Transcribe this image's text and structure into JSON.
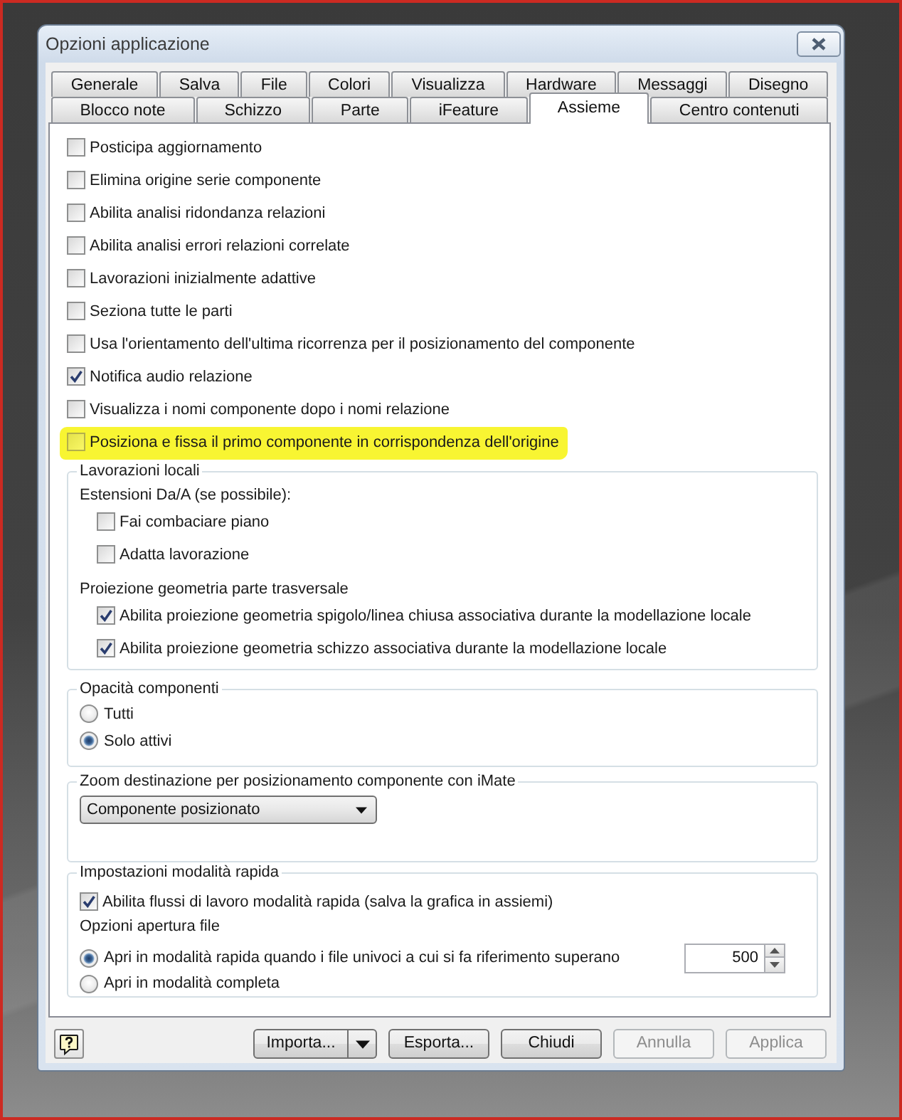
{
  "window": {
    "title": "Opzioni applicazione"
  },
  "tab_rows": [
    {
      "tabs": [
        {
          "label": "Generale",
          "selected": false
        },
        {
          "label": "Salva",
          "selected": false
        },
        {
          "label": "File",
          "selected": false
        },
        {
          "label": "Colori",
          "selected": false
        },
        {
          "label": "Visualizza",
          "selected": false
        },
        {
          "label": "Hardware",
          "selected": false
        },
        {
          "label": "Messaggi",
          "selected": false
        },
        {
          "label": "Disegno",
          "selected": false
        }
      ]
    },
    {
      "tabs": [
        {
          "label": "Blocco note",
          "selected": false
        },
        {
          "label": "Schizzo",
          "selected": false
        },
        {
          "label": "Parte",
          "selected": false
        },
        {
          "label": "iFeature",
          "selected": false
        },
        {
          "label": "Assieme",
          "selected": true
        },
        {
          "label": "Centro contenuti",
          "selected": false
        }
      ]
    }
  ],
  "options": [
    {
      "label": "Posticipa aggiornamento",
      "checked": false,
      "highlighted": false
    },
    {
      "label": "Elimina origine serie componente",
      "checked": false,
      "highlighted": false
    },
    {
      "label": "Abilita analisi ridondanza relazioni",
      "checked": false,
      "highlighted": false
    },
    {
      "label": "Abilita analisi errori relazioni correlate",
      "checked": false,
      "highlighted": false
    },
    {
      "label": "Lavorazioni inizialmente adattive",
      "checked": false,
      "highlighted": false
    },
    {
      "label": "Seziona tutte le parti",
      "checked": false,
      "highlighted": false
    },
    {
      "label": "Usa l'orientamento dell'ultima ricorrenza per il posizionamento del componente",
      "checked": false,
      "highlighted": false
    },
    {
      "label": "Notifica audio relazione",
      "checked": true,
      "highlighted": false
    },
    {
      "label": "Visualizza i nomi componente dopo i nomi relazione",
      "checked": false,
      "highlighted": false
    },
    {
      "label": "Posiziona e fissa il primo componente in corrispondenza dell'origine",
      "checked": false,
      "highlighted": true
    }
  ],
  "local_edits": {
    "title": "Lavorazioni locali",
    "sections": [
      {
        "heading": "Estensioni Da/A (se possibile):",
        "options": [
          {
            "label": "Fai combaciare piano",
            "checked": false
          },
          {
            "label": "Adatta lavorazione",
            "checked": false
          }
        ]
      },
      {
        "heading": "Proiezione geometria parte trasversale",
        "options": [
          {
            "label": "Abilita proiezione geometria spigolo/linea chiusa associativa durante la modellazione locale",
            "checked": true
          },
          {
            "label": "Abilita proiezione geometria schizzo associativa durante la modellazione locale",
            "checked": true
          }
        ]
      }
    ]
  },
  "component_opacity": {
    "title": "Opacità componenti",
    "choices": [
      {
        "label": "Tutti",
        "selected": false
      },
      {
        "label": "Solo attivi",
        "selected": true
      }
    ]
  },
  "imate_zoom": {
    "title": "Zoom destinazione per posizionamento componente con iMate",
    "dropdown": {
      "value": "Componente posizionato"
    }
  },
  "express_mode": {
    "title": "Impostazioni modalità rapida",
    "option": {
      "label": "Abilita flussi di lavoro modalità rapida (salva la grafica in assiemi)",
      "checked": true
    },
    "open_heading": "Opzioni apertura file",
    "choices": [
      {
        "label": "Apri in modalità rapida quando i file univoci a cui si fa riferimento superano",
        "selected": true,
        "threshold": "500"
      },
      {
        "label": "Apri in modalità completa",
        "selected": false
      }
    ]
  },
  "buttons": [
    {
      "kind": "help"
    },
    {
      "kind": "split",
      "label": "Importa...",
      "disabled": false
    },
    {
      "kind": "push",
      "label": "Esporta...",
      "disabled": false
    },
    {
      "kind": "push",
      "label": "Chiudi",
      "disabled": false
    },
    {
      "kind": "push",
      "label": "Annulla",
      "disabled": true
    },
    {
      "kind": "push",
      "label": "Applica",
      "disabled": true
    }
  ]
}
